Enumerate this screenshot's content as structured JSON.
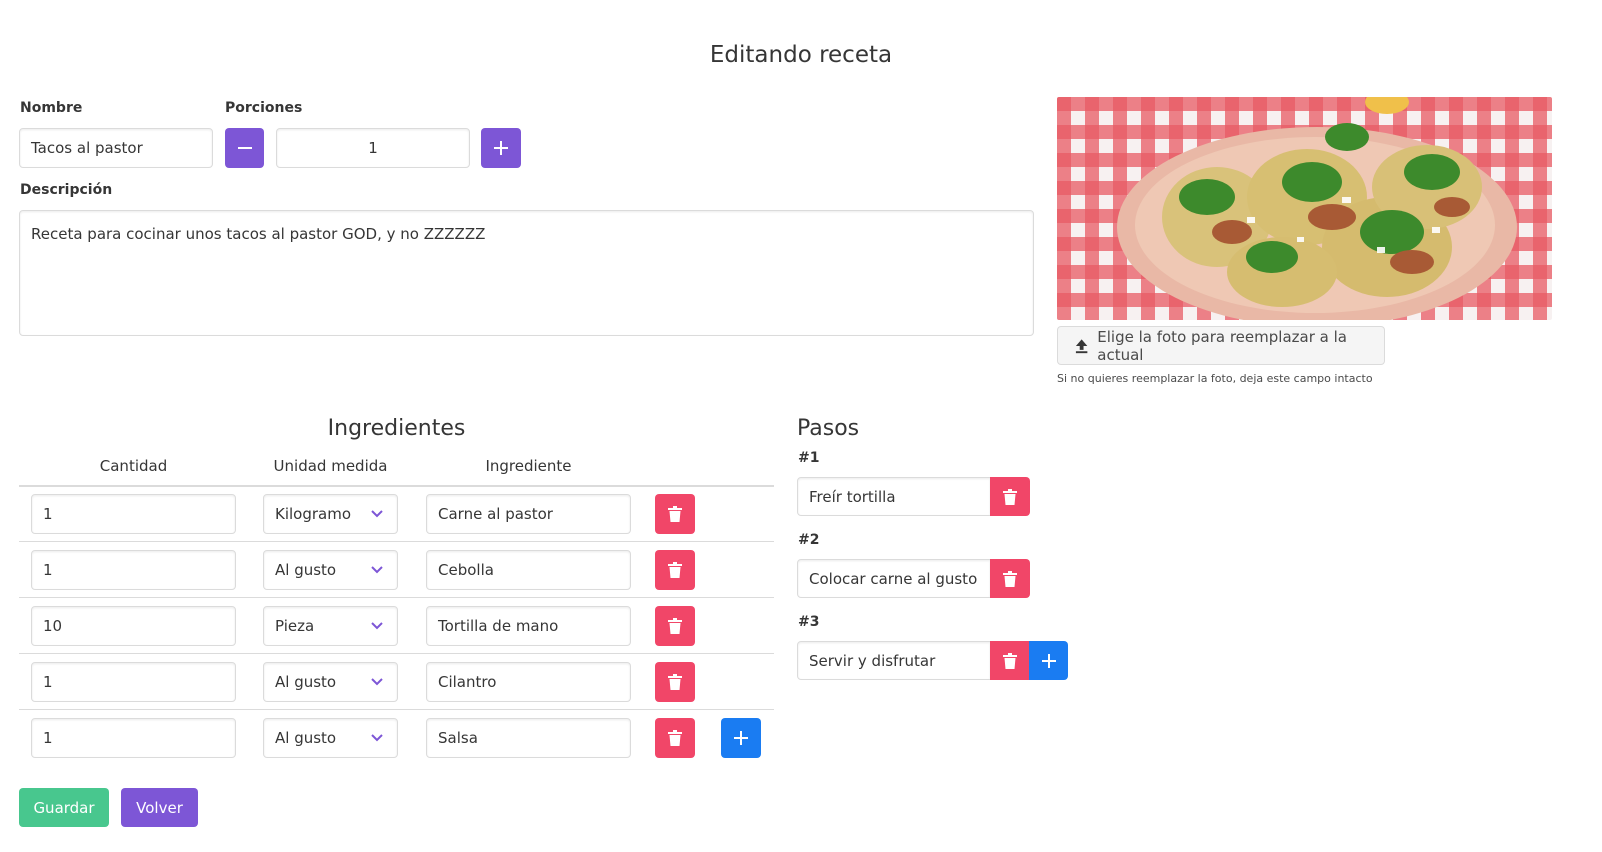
{
  "page": {
    "title": "Editando receta"
  },
  "form": {
    "nombre_label": "Nombre",
    "nombre_value": "Tacos al pastor",
    "porciones_label": "Porciones",
    "porciones_value": "1",
    "descripcion_label": "Descripción",
    "descripcion_value": "Receta para cocinar unos tacos al pastor GOD, y no ZZZZZZ"
  },
  "photo": {
    "upload_label": "Elige la foto para reemplazar a la actual",
    "help_text": "Si no quieres reemplazar la foto, deja este campo intacto"
  },
  "ingredientes": {
    "title": "Ingredientes",
    "headers": [
      "Cantidad",
      "Unidad medida",
      "Ingrediente"
    ],
    "rows": [
      {
        "cantidad": "1",
        "unidad": "Kilogramo",
        "ingrediente": "Carne al pastor"
      },
      {
        "cantidad": "1",
        "unidad": "Al gusto",
        "ingrediente": "Cebolla"
      },
      {
        "cantidad": "10",
        "unidad": "Pieza",
        "ingrediente": "Tortilla de mano"
      },
      {
        "cantidad": "1",
        "unidad": "Al gusto",
        "ingrediente": "Cilantro"
      },
      {
        "cantidad": "1",
        "unidad": "Al gusto",
        "ingrediente": "Salsa"
      }
    ]
  },
  "pasos": {
    "title": "Pasos",
    "steps": [
      {
        "num": "#1",
        "text": "Freír tortilla"
      },
      {
        "num": "#2",
        "text": "Colocar carne al gusto"
      },
      {
        "num": "#3",
        "text": "Servir y disfrutar"
      }
    ]
  },
  "actions": {
    "guardar": "Guardar",
    "volver": "Volver"
  },
  "colors": {
    "primary": "#7d56d6",
    "danger": "#f14668",
    "link": "#1a7cf2",
    "success": "#48c78e"
  }
}
